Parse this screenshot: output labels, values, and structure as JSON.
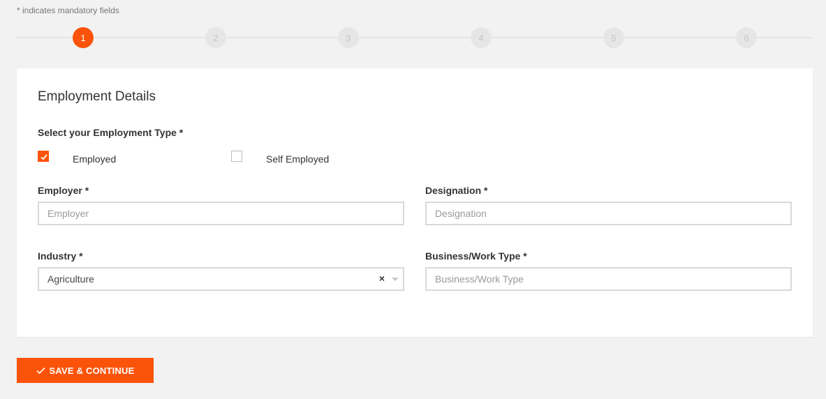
{
  "mandatory_note": "* indicates mandatory fields",
  "stepper": {
    "steps": [
      "1",
      "2",
      "3",
      "4",
      "5",
      "6"
    ],
    "current": 1,
    "colors": {
      "active": "#fb5309",
      "inactive": "#e6e6e6"
    }
  },
  "form": {
    "title": "Employment Details",
    "employment_type": {
      "label": "Select your Employment Type *",
      "options": [
        {
          "label": "Employed",
          "checked": true
        },
        {
          "label": "Self Employed",
          "checked": false
        }
      ]
    },
    "employer": {
      "label": "Employer *",
      "placeholder": "Employer",
      "value": ""
    },
    "designation": {
      "label": "Designation *",
      "placeholder": "Designation",
      "value": ""
    },
    "industry": {
      "label": "Industry *",
      "selected": "Agriculture",
      "clear_icon": "×"
    },
    "business_type": {
      "label": "Business/Work Type *",
      "placeholder": "Business/Work Type",
      "value": ""
    }
  },
  "actions": {
    "save_label": "SAVE & CONTINUE",
    "save_icon": "check-icon"
  },
  "colors": {
    "accent": "#fb5309",
    "background": "#f2f2f2",
    "card": "#ffffff"
  }
}
